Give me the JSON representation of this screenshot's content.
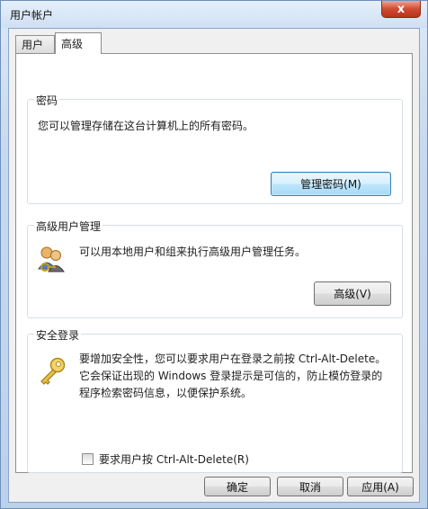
{
  "window": {
    "title": "用户帐户",
    "close_glyph": "x"
  },
  "tabs": [
    {
      "label": "用户",
      "selected": false
    },
    {
      "label": "高级",
      "selected": true
    }
  ],
  "groups": {
    "passwords": {
      "label": "密码",
      "description": "您可以管理存储在这台计算机上的所有密码。",
      "button_label": "管理密码(M)"
    },
    "advanced_user_management": {
      "label": "高级用户管理",
      "description": "可以用本地用户和组来执行高级用户管理任务。",
      "button_label": "高级(V)",
      "icon": "users-key-icon"
    },
    "secure_logon": {
      "label": "安全登录",
      "description_lines": [
        "要增加安全性，您可以要求用户在登录之前按 Ctrl-Alt-Delete。",
        "它会保证出现的 Windows 登录提示是可信的，防止模仿登录的",
        "程序检索密码信息，以便保护系统。"
      ],
      "checkbox_label": "要求用户按 Ctrl-Alt-Delete(R)",
      "checkbox_checked": false,
      "icon": "key-icon"
    }
  },
  "footer": {
    "ok_label": "确定",
    "cancel_label": "取消",
    "apply_label": "应用(A)"
  },
  "colors": {
    "frame": "#c7d9ef",
    "close_button": "#cf4b32",
    "focus_border": "#3c7fb1"
  }
}
